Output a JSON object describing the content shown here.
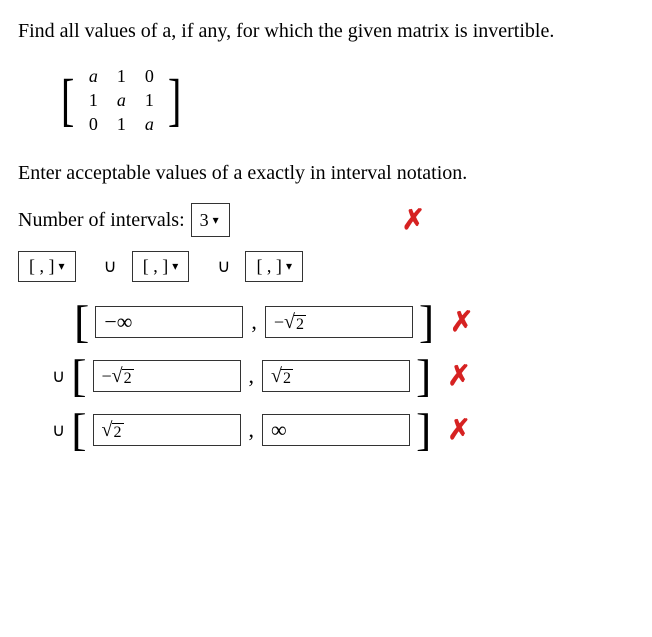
{
  "question_text": "Find all values of a, if any, for which the given matrix is invertible.",
  "matrix": {
    "r1": [
      "a",
      "1",
      "0"
    ],
    "r2": [
      "1",
      "a",
      "1"
    ],
    "r3": [
      "0",
      "1",
      "a"
    ]
  },
  "instruction_text": "Enter acceptable values of a exactly in interval notation.",
  "num_intervals_label": "Number of intervals:",
  "num_intervals_value": "3",
  "bracket_selects": {
    "b1": "[ , ]",
    "b2": "[ , ]",
    "b3": "[ , ]"
  },
  "union_symbol": "∪",
  "caret_symbol": "▾",
  "x_symbol": "✗",
  "intervals": [
    {
      "union_before": false,
      "left_bracket": "[",
      "right_bracket": "]",
      "left_type": "minus_inf",
      "left_plain": "−∞",
      "right_type": "neg_sqrt",
      "right_radicand": "2",
      "marked_wrong": true
    },
    {
      "union_before": true,
      "left_bracket": "[",
      "right_bracket": "]",
      "left_type": "neg_sqrt",
      "left_radicand": "2",
      "right_type": "sqrt",
      "right_radicand": "2",
      "marked_wrong": true
    },
    {
      "union_before": true,
      "left_bracket": "[",
      "right_bracket": "]",
      "left_type": "sqrt",
      "left_radicand": "2",
      "right_type": "inf",
      "right_plain": "∞",
      "marked_wrong": true
    }
  ]
}
